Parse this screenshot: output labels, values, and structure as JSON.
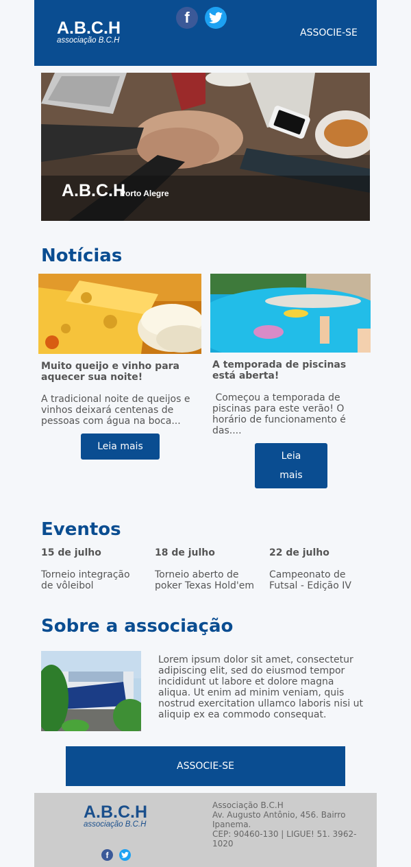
{
  "header": {
    "logo_main": "A.B.C.H",
    "logo_sub": "associação B.C.H",
    "social": {
      "facebook_icon": "facebook-icon",
      "twitter_icon": "twitter-icon"
    },
    "associe_label": "ASSOCIE-SE"
  },
  "hero": {
    "brand": "A.B.C.H",
    "city": "Porto Alegre"
  },
  "news": {
    "title": "Notícias",
    "items": [
      {
        "title": "Muito queijo e vinho para aquecer sua noite!",
        "text": "A tradicional noite de queijos e vinhos deixará centenas de pessoas com água na boca...",
        "button": "Leia mais"
      },
      {
        "title": "A temporada de piscinas está aberta!",
        "text": " Começou a temporada de piscinas para este verão! O horário de funcionamento é das....",
        "button": "Leia mais"
      }
    ]
  },
  "events": {
    "title": "Eventos",
    "items": [
      {
        "date": "15 de julho",
        "text": "Torneio integração de vôleibol"
      },
      {
        "date": "18 de julho",
        "text": "Torneio aberto de poker Texas Hold'em"
      },
      {
        "date": "22 de julho",
        "text": "Campeonato de Futsal - Edição IV"
      }
    ]
  },
  "about": {
    "title": "Sobre a associação",
    "text": "Lorem ipsum dolor sit amet, consectetur adipiscing elit, sed do eiusmod tempor incididunt ut labore et dolore magna aliqua. Ut enim ad minim veniam, quis nostrud exercitation ullamco laboris nisi ut aliquip ex ea commodo consequat.",
    "button": "ASSOCIE-SE"
  },
  "footer": {
    "logo_main": "A.B.C.H",
    "logo_sub": "associação B.C.H",
    "name": "Associação B.C.H",
    "address": "Av. Augusto Antônio, 456. Bairro Ipanema.",
    "contact": "CEP: 90460-130 | LIGUE! 51. 3962-1020"
  },
  "colors": {
    "primary": "#0a4d91",
    "footer_bg": "#cccccc",
    "page_bg": "#f5f7fa",
    "text": "#555555"
  }
}
